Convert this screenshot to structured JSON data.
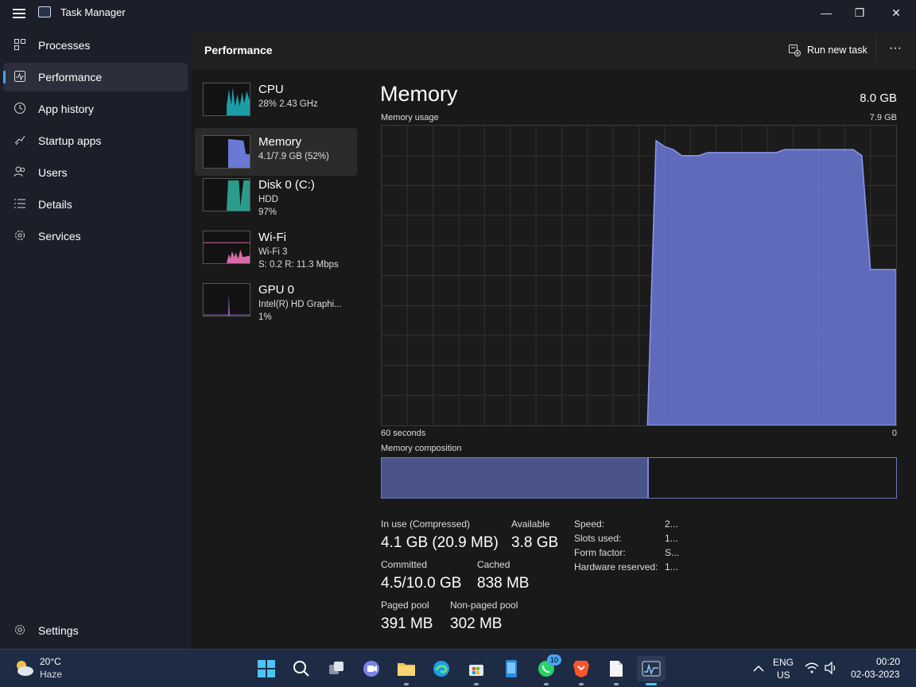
{
  "window": {
    "title": "Task Manager",
    "minimize": "—",
    "maximize": "❐",
    "close": "✕"
  },
  "sidebar": {
    "items": [
      {
        "label": "Processes",
        "icon": "processes-icon"
      },
      {
        "label": "Performance",
        "icon": "performance-icon",
        "active": true
      },
      {
        "label": "App history",
        "icon": "history-icon"
      },
      {
        "label": "Startup apps",
        "icon": "startup-icon"
      },
      {
        "label": "Users",
        "icon": "users-icon"
      },
      {
        "label": "Details",
        "icon": "details-icon"
      },
      {
        "label": "Services",
        "icon": "services-icon"
      }
    ],
    "settings": "Settings"
  },
  "header": {
    "title": "Performance",
    "run_task": "Run new task",
    "more": "···"
  },
  "devices": [
    {
      "name": "CPU",
      "sub1": "28% 2.43 GHz",
      "sub2": "",
      "sub3": ""
    },
    {
      "name": "Memory",
      "sub1": "4.1/7.9 GB (52%)",
      "sub2": "",
      "sub3": ""
    },
    {
      "name": "Disk 0 (C:)",
      "sub1": "HDD",
      "sub2": "97%",
      "sub3": ""
    },
    {
      "name": "Wi-Fi",
      "sub1": "Wi-Fi 3",
      "sub2": "S: 0.2 R: 11.3 Mbps",
      "sub3": ""
    },
    {
      "name": "GPU 0",
      "sub1": "Intel(R) HD Graphi...",
      "sub2": "1%",
      "sub3": ""
    }
  ],
  "memory": {
    "title": "Memory",
    "total": "8.0 GB",
    "usage_label": "Memory usage",
    "usage_max": "7.9 GB",
    "x_left": "60 seconds",
    "x_right": "0",
    "composition_label": "Memory composition",
    "usage_series_fraction": [
      0,
      0,
      0,
      0,
      0,
      0,
      0,
      0,
      0,
      0,
      0,
      0,
      0,
      0,
      0,
      0,
      0,
      0,
      0,
      0,
      0,
      0,
      0,
      0,
      0,
      0,
      0,
      0,
      0,
      0,
      0,
      0,
      0.95,
      0.93,
      0.92,
      0.9,
      0.9,
      0.9,
      0.91,
      0.91,
      0.91,
      0.91,
      0.91,
      0.91,
      0.91,
      0.91,
      0.91,
      0.92,
      0.92,
      0.92,
      0.92,
      0.92,
      0.92,
      0.92,
      0.92,
      0.92,
      0.9,
      0.52,
      0.52,
      0.52,
      0.52
    ],
    "composition_in_use_fraction": 0.52
  },
  "stats": {
    "in_use_label": "In use (Compressed)",
    "in_use_value": "4.1 GB (20.9 MB)",
    "available_label": "Available",
    "available_value": "3.8 GB",
    "committed_label": "Committed",
    "committed_value": "4.5/10.0 GB",
    "cached_label": "Cached",
    "cached_value": "838 MB",
    "paged_label": "Paged pool",
    "paged_value": "391 MB",
    "nonpaged_label": "Non-paged pool",
    "nonpaged_value": "302 MB",
    "speed_label": "Speed:",
    "speed_value": "2...",
    "slots_label": "Slots used:",
    "slots_value": "1...",
    "form_label": "Form factor:",
    "form_value": "S...",
    "hw_label": "Hardware reserved:",
    "hw_value": "1..."
  },
  "taskbar": {
    "weather_temp": "20°C",
    "weather_desc": "Haze",
    "lang1": "ENG",
    "lang2": "US",
    "time": "00:20",
    "date": "02-03-2023",
    "whatsapp_badge": "10"
  },
  "colors": {
    "memory": "#6b78d6",
    "cpu": "#1fb6c1",
    "disk": "#2fb5a0",
    "wifi": "#d86aa8",
    "gpu": "#9b6bd6",
    "accent": "#4aa3f0"
  }
}
